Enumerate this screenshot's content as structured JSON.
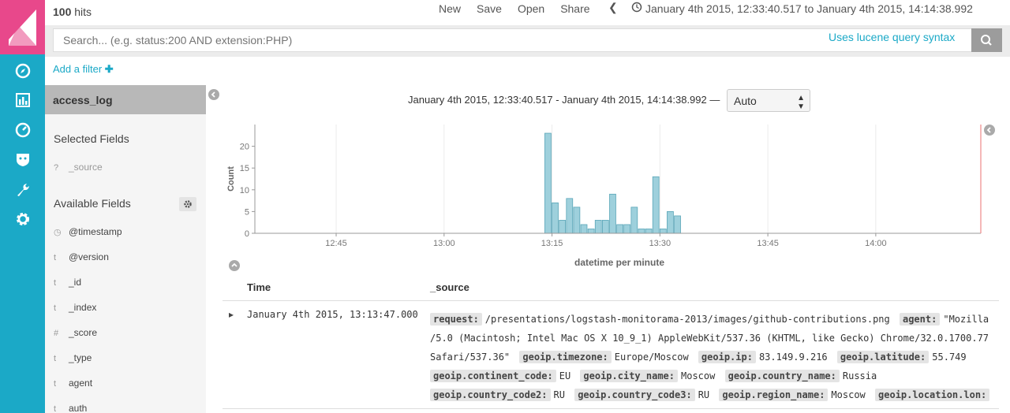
{
  "header": {
    "hits_count": "100",
    "hits_label": "hits",
    "menu": [
      "New",
      "Save",
      "Open",
      "Share"
    ],
    "time_range": "January 4th 2015, 12:33:40.517 to January 4th 2015, 14:14:38.992"
  },
  "nav": {
    "icons": [
      "compass-icon",
      "bar-chart-icon",
      "dashboard-icon",
      "shield-icon",
      "wrench-icon",
      "gear-icon"
    ]
  },
  "search": {
    "placeholder": "Search... (e.g. status:200 AND extension:PHP)",
    "lucene_link": "Uses lucene query syntax"
  },
  "filter": {
    "add_label": "Add a filter"
  },
  "sidebar": {
    "index_name": "access_log",
    "selected_title": "Selected Fields",
    "selected_fields": [
      {
        "type": "?",
        "name": "_source"
      }
    ],
    "available_title": "Available Fields",
    "available_fields": [
      {
        "type": "◷",
        "name": "@timestamp"
      },
      {
        "type": "t",
        "name": "@version"
      },
      {
        "type": "t",
        "name": "_id"
      },
      {
        "type": "t",
        "name": "_index"
      },
      {
        "type": "#",
        "name": "_score"
      },
      {
        "type": "t",
        "name": "_type"
      },
      {
        "type": "t",
        "name": "agent"
      },
      {
        "type": "t",
        "name": "auth"
      }
    ]
  },
  "main": {
    "chart_range": "January 4th 2015, 12:33:40.517 - January 4th 2015, 14:14:38.992 —",
    "interval": "Auto",
    "table_headers": [
      "Time",
      "_source"
    ],
    "row": {
      "time": "January 4th 2015, 13:13:47.000",
      "line1_key": "request:",
      "line1_val": "/presentations/logstash-monitorama-2013/images/github-contributions.png",
      "agent_key": "agent:",
      "agent_val": "\"Mozilla",
      "line2": "/5.0 (Macintosh; Intel Mac OS X 10_9_1) AppleWebKit/537.36 (KHTML, like Gecko) Chrome/32.0.1700.77",
      "line3_start": "Safari/537.36\"",
      "pairs3": [
        {
          "k": "geoip.timezone:",
          "v": "Europe/Moscow"
        },
        {
          "k": "geoip.ip:",
          "v": "83.149.9.216"
        },
        {
          "k": "geoip.latitude:",
          "v": "55.749"
        }
      ],
      "pairs4": [
        {
          "k": "geoip.continent_code:",
          "v": "EU"
        },
        {
          "k": "geoip.city_name:",
          "v": "Moscow"
        },
        {
          "k": "geoip.country_name:",
          "v": "Russia"
        }
      ],
      "pairs5": [
        {
          "k": "geoip.country_code2:",
          "v": "RU"
        },
        {
          "k": "geoip.country_code3:",
          "v": "RU"
        },
        {
          "k": "geoip.region_name:",
          "v": "Moscow"
        },
        {
          "k": "geoip.location.lon:",
          "v": ""
        }
      ]
    }
  },
  "colors": {
    "nav": "#1ba9c7",
    "logo": "#e8488b",
    "bar": "#9ed0dc",
    "bar_stroke": "#5aa6b8",
    "link": "#1ba9c7"
  },
  "chart_data": {
    "type": "bar",
    "xlabel": "datetime per minute",
    "ylabel": "Count",
    "ylim": [
      0,
      25
    ],
    "y_ticks": [
      0,
      5,
      10,
      15,
      20
    ],
    "x_tick_labels": [
      "12:45",
      "13:00",
      "13:15",
      "13:30",
      "13:45",
      "14:00"
    ],
    "x_ticks_min": [
      45,
      60,
      75,
      90,
      105,
      120
    ],
    "x_range_min": [
      33.7,
      134.6
    ],
    "bars": [
      {
        "minute": 74,
        "value": 23
      },
      {
        "minute": 75,
        "value": 7
      },
      {
        "minute": 76,
        "value": 3
      },
      {
        "minute": 77,
        "value": 8
      },
      {
        "minute": 78,
        "value": 6
      },
      {
        "minute": 79,
        "value": 2
      },
      {
        "minute": 80,
        "value": 1
      },
      {
        "minute": 81,
        "value": 3
      },
      {
        "minute": 82,
        "value": 3
      },
      {
        "minute": 83,
        "value": 9
      },
      {
        "minute": 84,
        "value": 2
      },
      {
        "minute": 85,
        "value": 2
      },
      {
        "minute": 86,
        "value": 6
      },
      {
        "minute": 87,
        "value": 1
      },
      {
        "minute": 88,
        "value": 1
      },
      {
        "minute": 89,
        "value": 13
      },
      {
        "minute": 90,
        "value": 1
      },
      {
        "minute": 91,
        "value": 5
      },
      {
        "minute": 92,
        "value": 4
      }
    ]
  }
}
